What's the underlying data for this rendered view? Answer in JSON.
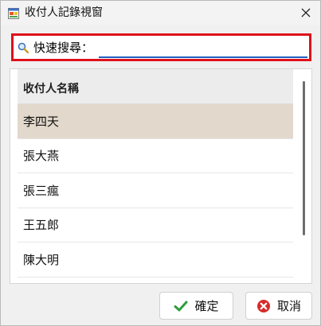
{
  "window": {
    "title": "收付人記錄視窗",
    "app_icon": "form-app-icon",
    "close_icon": "close-icon"
  },
  "search": {
    "label": "快速搜尋：",
    "value": "",
    "placeholder": "",
    "icon": "magnifier-icon",
    "highlight_color": "#e0101a"
  },
  "list": {
    "header": "收付人名稱",
    "rows": [
      "李四天",
      "張大燕",
      "張三瘋",
      "王五郎",
      "陳大明"
    ],
    "selected_index": 0,
    "selected_color": "#e2d8cb"
  },
  "buttons": {
    "ok_label": "確定",
    "ok_icon": "checkmark-icon",
    "cancel_label": "取消",
    "cancel_icon": "cancel-circle-icon"
  }
}
